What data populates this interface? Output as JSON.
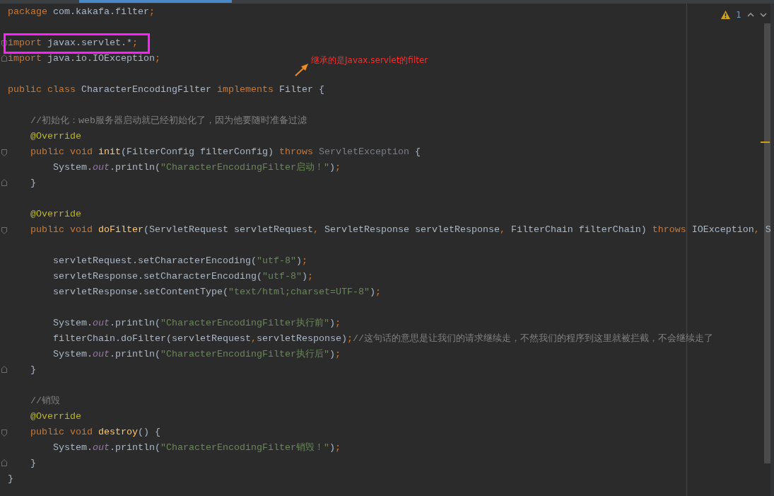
{
  "editor": {
    "warnings": "1"
  },
  "lines": [
    {
      "kind": "code",
      "tokens": [
        {
          "kind": "kw",
          "text": "package"
        },
        {
          "kind": "plain",
          "text": " com.kakafa.filter"
        },
        {
          "kind": "kw",
          "text": ";"
        }
      ]
    },
    {
      "kind": "blank"
    },
    {
      "kind": "code",
      "fold_start": true,
      "highlighted": true,
      "tokens": [
        {
          "kind": "kw",
          "text": "import"
        },
        {
          "kind": "plain",
          "text": " javax.servlet.*"
        },
        {
          "kind": "kw",
          "text": ";"
        }
      ]
    },
    {
      "kind": "code",
      "fold_end": true,
      "tokens": [
        {
          "kind": "kw",
          "text": "import"
        },
        {
          "kind": "plain",
          "text": " java.io.IOException"
        },
        {
          "kind": "kw",
          "text": ";"
        }
      ]
    },
    {
      "kind": "blank",
      "callout": "继承的是Javax.servlet的filter"
    },
    {
      "kind": "code",
      "tokens": [
        {
          "kind": "kw",
          "text": "public class "
        },
        {
          "kind": "plain",
          "text": "CharacterEncodingFilter "
        },
        {
          "kind": "kw",
          "text": "implements "
        },
        {
          "kind": "plain",
          "text": "Filter {"
        }
      ]
    },
    {
      "kind": "blank"
    },
    {
      "kind": "code",
      "tokens": [
        {
          "kind": "cmt",
          "text": "    //初始化：web服务器启动就已经初始化了，因为他要随时准备过滤"
        }
      ]
    },
    {
      "kind": "code",
      "tokens": [
        {
          "kind": "ann",
          "text": "    @Override"
        }
      ]
    },
    {
      "kind": "code",
      "fold_start": true,
      "tokens": [
        {
          "kind": "kw",
          "text": "    public void "
        },
        {
          "kind": "fn",
          "text": "init"
        },
        {
          "kind": "plain",
          "text": "(FilterConfig filterConfig) "
        },
        {
          "kind": "kw",
          "text": "throws "
        },
        {
          "kind": "unused",
          "text": "ServletException"
        },
        {
          "kind": "plain",
          "text": " {"
        }
      ]
    },
    {
      "kind": "code",
      "tokens": [
        {
          "kind": "plain",
          "text": "        System."
        },
        {
          "kind": "field",
          "text": "out"
        },
        {
          "kind": "plain",
          "text": ".println("
        },
        {
          "kind": "str",
          "text": "\"CharacterEncodingFilter启动！\""
        },
        {
          "kind": "plain",
          "text": ")"
        },
        {
          "kind": "kw",
          "text": ";"
        }
      ]
    },
    {
      "kind": "code",
      "fold_end": true,
      "tokens": [
        {
          "kind": "plain",
          "text": "    }"
        }
      ]
    },
    {
      "kind": "blank"
    },
    {
      "kind": "code",
      "tokens": [
        {
          "kind": "ann",
          "text": "    @Override"
        }
      ]
    },
    {
      "kind": "code",
      "fold_start": true,
      "tokens": [
        {
          "kind": "kw",
          "text": "    public void "
        },
        {
          "kind": "fn",
          "text": "doFilter"
        },
        {
          "kind": "plain",
          "text": "(ServletRequest servletRequest"
        },
        {
          "kind": "kw",
          "text": ", "
        },
        {
          "kind": "plain",
          "text": "ServletResponse servletResponse"
        },
        {
          "kind": "kw",
          "text": ", "
        },
        {
          "kind": "plain",
          "text": "FilterChain filterChain) "
        },
        {
          "kind": "kw",
          "text": "throws "
        },
        {
          "kind": "plain",
          "text": "IOException"
        },
        {
          "kind": "kw",
          "text": ", "
        },
        {
          "kind": "plain",
          "text": "S"
        }
      ]
    },
    {
      "kind": "blank"
    },
    {
      "kind": "code",
      "tokens": [
        {
          "kind": "plain",
          "text": "        servletRequest.setCharacterEncoding("
        },
        {
          "kind": "str",
          "text": "\"utf-8\""
        },
        {
          "kind": "plain",
          "text": ")"
        },
        {
          "kind": "kw",
          "text": ";"
        }
      ]
    },
    {
      "kind": "code",
      "tokens": [
        {
          "kind": "plain",
          "text": "        servletResponse.setCharacterEncoding("
        },
        {
          "kind": "str",
          "text": "\"utf-8\""
        },
        {
          "kind": "plain",
          "text": ")"
        },
        {
          "kind": "kw",
          "text": ";"
        }
      ]
    },
    {
      "kind": "code",
      "tokens": [
        {
          "kind": "plain",
          "text": "        servletResponse.setContentType("
        },
        {
          "kind": "str",
          "text": "\"text/html;charset=UTF-8\""
        },
        {
          "kind": "plain",
          "text": ")"
        },
        {
          "kind": "kw",
          "text": ";"
        }
      ]
    },
    {
      "kind": "blank"
    },
    {
      "kind": "code",
      "tokens": [
        {
          "kind": "plain",
          "text": "        System."
        },
        {
          "kind": "field",
          "text": "out"
        },
        {
          "kind": "plain",
          "text": ".println("
        },
        {
          "kind": "str",
          "text": "\"CharacterEncodingFilter执行前\""
        },
        {
          "kind": "plain",
          "text": ")"
        },
        {
          "kind": "kw",
          "text": ";"
        }
      ]
    },
    {
      "kind": "code",
      "tokens": [
        {
          "kind": "plain",
          "text": "        filterChain.doFilter(servletRequest"
        },
        {
          "kind": "kw",
          "text": ","
        },
        {
          "kind": "plain",
          "text": "servletResponse)"
        },
        {
          "kind": "kw",
          "text": ";"
        },
        {
          "kind": "cmt",
          "text": "//这句话的意思是让我们的请求继续走，不然我们的程序到这里就被拦截，不会继续走了"
        }
      ]
    },
    {
      "kind": "code",
      "tokens": [
        {
          "kind": "plain",
          "text": "        System."
        },
        {
          "kind": "field",
          "text": "out"
        },
        {
          "kind": "plain",
          "text": ".println("
        },
        {
          "kind": "str",
          "text": "\"CharacterEncodingFilter执行后\""
        },
        {
          "kind": "plain",
          "text": ")"
        },
        {
          "kind": "kw",
          "text": ";"
        }
      ]
    },
    {
      "kind": "code",
      "fold_end": true,
      "tokens": [
        {
          "kind": "plain",
          "text": "    }"
        }
      ]
    },
    {
      "kind": "blank"
    },
    {
      "kind": "code",
      "tokens": [
        {
          "kind": "cmt",
          "text": "    //销毁"
        }
      ]
    },
    {
      "kind": "code",
      "tokens": [
        {
          "kind": "ann",
          "text": "    @Override"
        }
      ]
    },
    {
      "kind": "code",
      "fold_start": true,
      "tokens": [
        {
          "kind": "kw",
          "text": "    public void "
        },
        {
          "kind": "fn",
          "text": "destroy"
        },
        {
          "kind": "plain",
          "text": "() {"
        }
      ]
    },
    {
      "kind": "code",
      "tokens": [
        {
          "kind": "plain",
          "text": "        System."
        },
        {
          "kind": "field",
          "text": "out"
        },
        {
          "kind": "plain",
          "text": ".println("
        },
        {
          "kind": "str",
          "text": "\"CharacterEncodingFilter销毁！\""
        },
        {
          "kind": "plain",
          "text": ")"
        },
        {
          "kind": "kw",
          "text": ";"
        }
      ]
    },
    {
      "kind": "code",
      "fold_end": true,
      "tokens": [
        {
          "kind": "plain",
          "text": "    }"
        }
      ]
    },
    {
      "kind": "code",
      "tokens": [
        {
          "kind": "plain",
          "text": "}"
        }
      ]
    }
  ]
}
